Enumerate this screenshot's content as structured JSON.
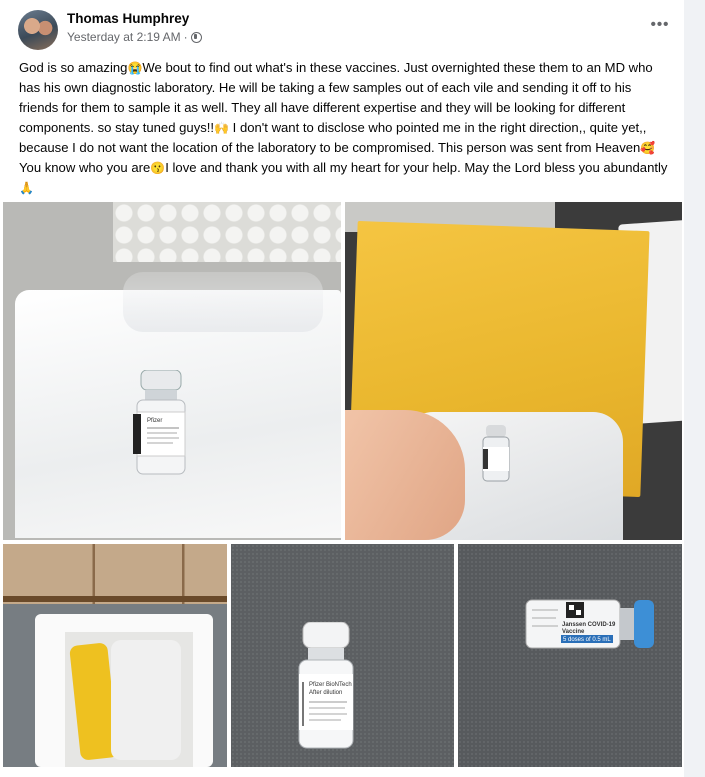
{
  "post": {
    "author": "Thomas Humphrey",
    "timestamp": "Yesterday at 2:19 AM",
    "separator": "·",
    "privacy_icon": "globe-icon",
    "more_icon": "more-horizontal-icon",
    "more_label": "•••",
    "text": {
      "t1": "God is so amazing",
      "e1": "😭",
      "t2": "We bout to find out what's in these vaccines. Just overnighted these them to an MD who has his own diagnostic laboratory.  He will be taking a few samples out of each vile and sending it off to his friends for them to sample it as well. They all have different expertise and they will be looking for different components. so stay tuned guys!!",
      "e2": "🙌",
      "t3": "  I don't want to disclose who pointed me in the right direction,, quite yet,, because I do not want the location of the laboratory to be compromised. This person was sent from Heaven",
      "e3": "🥰",
      "t4": " You know who you are",
      "e4": "😗",
      "t5": "I love and thank you with all my heart for your help. May the Lord bless you abundantly",
      "e5": "🙏"
    }
  },
  "photos": {
    "vial_label_pfizer": "Pfizer",
    "vial_label_biontech": "Pfizer BioNTech",
    "vial_label_dilution": "After dilution",
    "janssen_label_1": "Janssen COVID-19",
    "janssen_label_2": "Vaccine",
    "janssen_label_3": "5 doses of 0.5 mL"
  },
  "colors": {
    "janssen_cap": "#3d8fd6",
    "envelope": "#f0bf3a"
  }
}
